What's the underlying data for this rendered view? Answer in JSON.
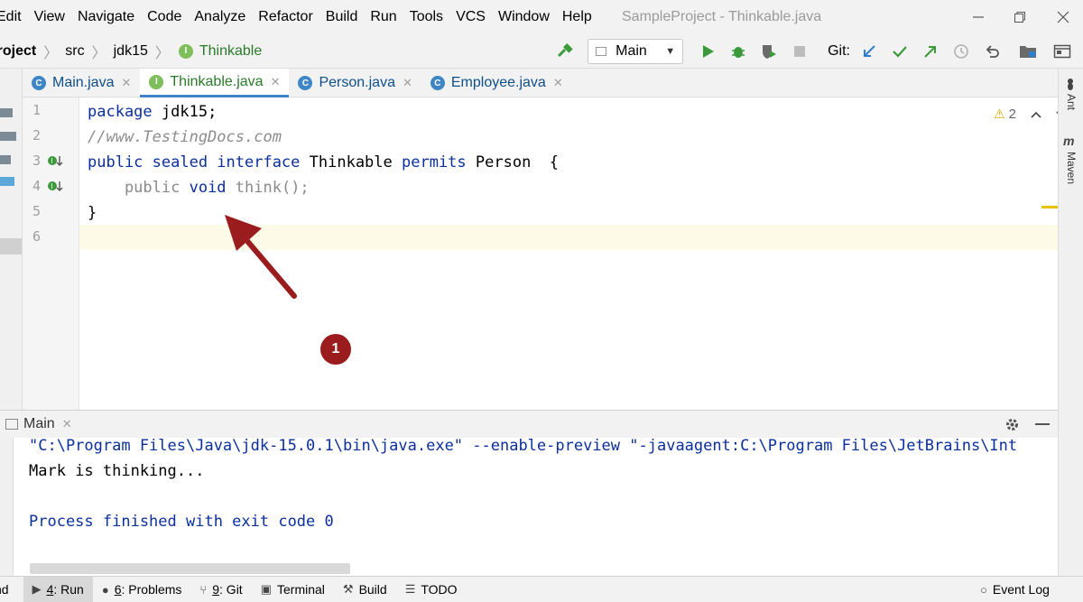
{
  "menu": [
    "Edit",
    "View",
    "Navigate",
    "Code",
    "Analyze",
    "Refactor",
    "Build",
    "Run",
    "Tools",
    "VCS",
    "Window",
    "Help"
  ],
  "window_title": "SampleProject - Thinkable.java",
  "breadcrumb": {
    "project": "Project",
    "src": "src",
    "pkg": "jdk15",
    "file": "Thinkable"
  },
  "run_config": "Main",
  "git_label": "Git:",
  "tabs": [
    {
      "label": "Main.java",
      "icon": "class-icon"
    },
    {
      "label": "Thinkable.java",
      "icon": "interface-icon",
      "active": true
    },
    {
      "label": "Person.java",
      "icon": "class-icon"
    },
    {
      "label": "Employee.java",
      "icon": "class-icon"
    }
  ],
  "line_numbers": [
    "1",
    "2",
    "3",
    "4",
    "5",
    "6"
  ],
  "code": {
    "l1_kw": "package",
    "l1_rest": " jdk15;",
    "l2": "//www.TestingDocs.com",
    "l3_kw1": "public sealed interface",
    "l3_mid": " Thinkable ",
    "l3_kw2": "permits",
    "l3_rest": " Person  {",
    "l4_pub": "    public",
    "l4_void": " void",
    "l4_rest": " think();",
    "l5": "}"
  },
  "inspection_count": "2",
  "run_panel": {
    "tab": "Main"
  },
  "console_lines": [
    "\"C:\\Program Files\\Java\\jdk-15.0.1\\bin\\java.exe\" --enable-preview \"-javaagent:C:\\Program Files\\JetBrains\\Int",
    "Mark is thinking...",
    "",
    "Process finished with exit code 0"
  ],
  "right_tools": [
    "Ant",
    "Maven"
  ],
  "status": {
    "items": [
      {
        "num": "4",
        "label": ": Run"
      },
      {
        "num": "6",
        "label": ": Problems"
      },
      {
        "num": "9",
        "label": ": Git"
      },
      {
        "num": "",
        "label": "Terminal"
      },
      {
        "num": "",
        "label": "Build"
      },
      {
        "num": "",
        "label": "TODO"
      }
    ],
    "event_log": "Event Log"
  },
  "annotation": {
    "badge": "1"
  },
  "colors": {
    "keyword": "#0b2f9c",
    "console_blue": "#0b2f9c",
    "annotation": "#9b1c1c",
    "interface_icon": "#7fbf5b",
    "class_icon": "#3e86c6"
  }
}
